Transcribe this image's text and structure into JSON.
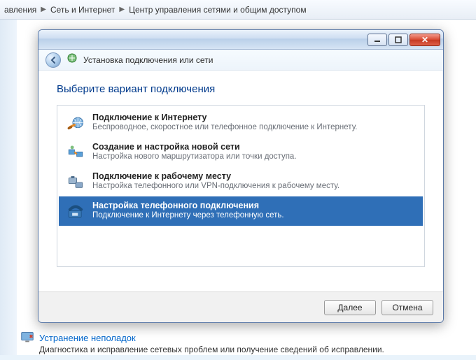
{
  "breadcrumb": {
    "p0": "авления",
    "p1": "Сеть и Интернет",
    "p2": "Центр управления сетями и общим доступом"
  },
  "dialog": {
    "header": "Установка подключения или сети",
    "heading": "Выберите вариант подключения",
    "options": [
      {
        "title": "Подключение к Интернету",
        "desc": "Беспроводное, скоростное или телефонное подключение к Интернету."
      },
      {
        "title": "Создание и настройка новой сети",
        "desc": "Настройка нового маршрутизатора или точки доступа."
      },
      {
        "title": "Подключение к рабочему месту",
        "desc": "Настройка телефонного или VPN-подключения к рабочему месту."
      },
      {
        "title": "Настройка телефонного подключения",
        "desc": "Подключение к Интернету через телефонную сеть."
      }
    ],
    "selected_index": 3,
    "buttons": {
      "next": "Далее",
      "cancel": "Отмена"
    }
  },
  "footer": {
    "title": "Устранение неполадок",
    "desc": "Диагностика и исправление сетевых проблем или получение сведений об исправлении."
  }
}
